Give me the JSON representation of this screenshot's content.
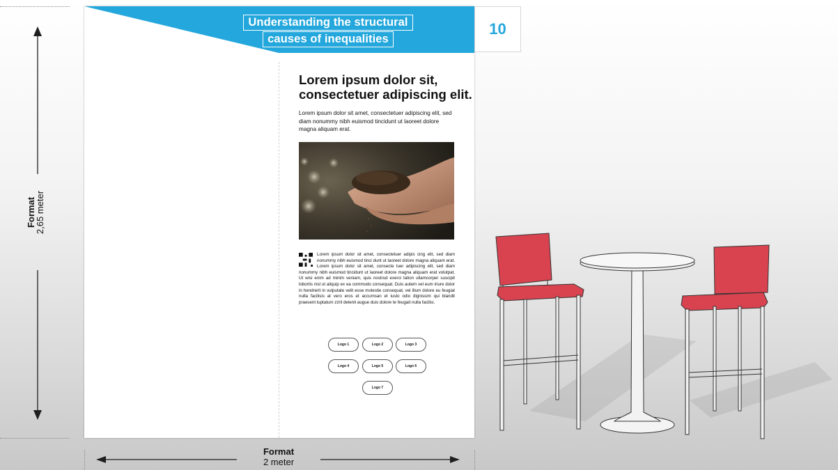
{
  "banner": {
    "title_line1": "Understanding the structural",
    "title_line2": "causes of inequalities",
    "page_number": "10"
  },
  "content": {
    "heading": "Lorem ipsum dolor sit, consectetuer adipiscing elit.",
    "intro": "Lorem ipsum dolor sit amet, consectetuer adipiscing elit, sed diam nonummy nibh euismod tincidunt ut laoreet dolore magna aliquam erat.",
    "body": "Lorem ipsum dolor sit amet, consectetuer adipis cing elit, sed diam nonummy nibh euismod tinci dunt ut laoreet dolore magna aliquam erat. Lorem ipsum dolor sit amet, consecte tuer adipiscing elit, sed diam nonummy nibh euismod tincidunt ut laoreet dolore magna aliquam erat volutpat. Ut wisi enim ad minim veniam, quis nostrud exerci tation ullamcorper suscipit lobortis nisl ut aliquip ex ea commodo consequat. Duis autem vel eum iriure dolor in hendrerit in vulputate velit esse molestie consequat, vel illum dolore eu feugiat nulla facilisis at vero eros et accumsan et iusto odio dignissim qui blandit praesent luptatum zzril delenit augue duis dolore te feugait nulla facilisi.",
    "logos": [
      "Logo 1",
      "Logo 2",
      "Logo 3",
      "Logo 4",
      "Logo 5",
      "Logo 6",
      "Logo 7"
    ]
  },
  "dimensions": {
    "height_label": "Format",
    "height_value": "2,65 meter",
    "width_label": "Format",
    "width_value": "2 meter"
  },
  "colors": {
    "accent_blue": "#23a7dc",
    "chair_red": "#d8434f"
  }
}
